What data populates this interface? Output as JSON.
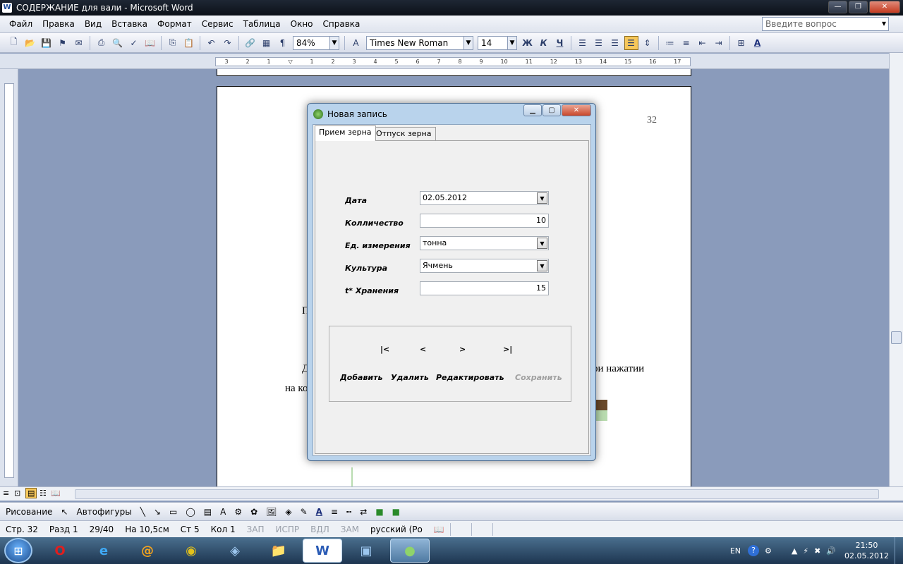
{
  "window": {
    "title": "СОДЕРЖАНИЕ для вали - Microsoft Word",
    "app_icon": "W"
  },
  "menu": [
    "Файл",
    "Правка",
    "Вид",
    "Вставка",
    "Формат",
    "Сервис",
    "Таблица",
    "Окно",
    "Справка"
  ],
  "help_box": {
    "placeholder": "Введите вопрос"
  },
  "toolbar": {
    "zoom": "84%",
    "font": "Times New Roman",
    "size": "14",
    "bold": "Ж",
    "italic": "К",
    "underline": "Ч",
    "paragraph_mark": "¶"
  },
  "ruler_marks": [
    "3",
    "2",
    "1",
    "",
    "1",
    "2",
    "3",
    "4",
    "5",
    "6",
    "7",
    "8",
    "9",
    "10",
    "11",
    "12",
    "13",
    "14",
    "15",
    "16",
    "17"
  ],
  "document": {
    "page_number": "32",
    "text_fragments": [
      "П",
      "Д",
      "на ко",
      "ри нажатии"
    ]
  },
  "dialog": {
    "title": "Новая запись",
    "tabs": [
      "Прием зерна",
      "Отпуск зерна"
    ],
    "fields": {
      "date_label": "Дата",
      "date_value": "02.05.2012",
      "qty_label": "Колличество",
      "qty_value": "10",
      "unit_label": "Ед. измерения",
      "unit_value": "тонна",
      "crop_label": "Культура",
      "crop_value": "Ячмень",
      "temp_label": "t* Хранения",
      "temp_value": "15"
    },
    "nav": {
      "first": "|<",
      "prev": "<",
      "next": ">",
      "last": ">|"
    },
    "actions": {
      "add": "Добавить",
      "delete": "Удалить",
      "edit": "Редактировать",
      "save": "Сохранить"
    }
  },
  "drawbar": {
    "drawing": "Рисование",
    "autoshapes": "Автофигуры"
  },
  "status": {
    "page": "Стр. 32",
    "section": "Разд 1",
    "pages": "29/40",
    "at": "На 10,5см",
    "line": "Ст 5",
    "col": "Кол 1",
    "rec": "ЗАП",
    "trk": "ИСПР",
    "ext": "ВДЛ",
    "ovr": "ЗАМ",
    "lang": "русский (Ро"
  },
  "taskbar": {
    "lang": "EN",
    "time": "21:50",
    "date": "02.05.2012"
  }
}
